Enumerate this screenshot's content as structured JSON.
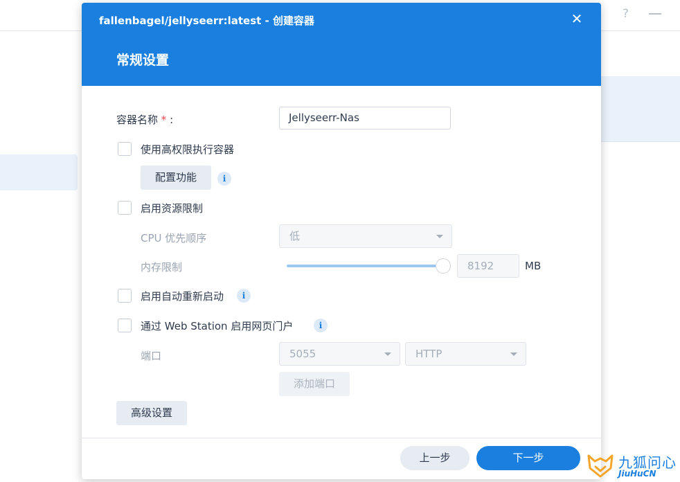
{
  "dialog": {
    "title": "fallenbagel/jellyseerr:latest - 创建容器",
    "section": "常规设置",
    "close_icon": "close-icon"
  },
  "form": {
    "container_name_label": "容器名称",
    "required_mark": "*",
    "colon": ":",
    "container_name_value": "Jellyseerr-Nas",
    "privileged": {
      "label": "使用高权限执行容器",
      "checked": false
    },
    "capabilities_button": "配置功能",
    "resource_limit": {
      "label": "启用资源限制",
      "checked": false
    },
    "cpu_priority_label": "CPU 优先顺序",
    "cpu_priority_value": "低",
    "memory_limit_label": "内存限制",
    "memory_limit_value": "8192",
    "memory_unit": "MB",
    "auto_restart": {
      "label": "启用自动重新启动",
      "checked": false
    },
    "web_station": {
      "label": "通过 Web Station 启用网页门户",
      "checked": false
    },
    "port_label": "端口",
    "port_value": "5055",
    "protocol_value": "HTTP",
    "add_port_button": "添加端口",
    "advanced_button": "高级设置"
  },
  "footer": {
    "prev_button": "上一步",
    "next_button": "下一步"
  },
  "background": {
    "help_icon": "?"
  },
  "watermark": {
    "cn": "九狐问心",
    "en": "JiuHuCN"
  },
  "colors": {
    "accent": "#1a7fdf",
    "required": "#e84a4a"
  }
}
